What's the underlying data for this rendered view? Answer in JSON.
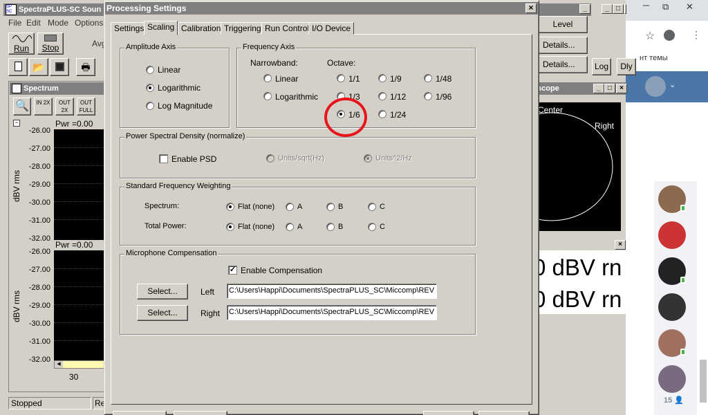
{
  "main_window": {
    "title": "SpectraPLUS-SC Soun",
    "menu": [
      "File",
      "Edit",
      "Mode",
      "Options"
    ],
    "run": "Run",
    "stop": "Stop",
    "avg": "Avg",
    "status": "Stopped",
    "status2": "Re"
  },
  "spectrum": {
    "title": "Spectrum",
    "zoom_in": "IN 2X",
    "zoom_out": "OUT 2X",
    "zoom_full": "OUT FULL",
    "top": {
      "header": "Pwr =0.00",
      "yticks": [
        "-26.00",
        "-27.00",
        "-28.00",
        "-29.00",
        "-30.00",
        "-31.00",
        "-32.00"
      ],
      "ylabel": "dBV rms"
    },
    "bottom": {
      "header": "Pwr =0.00",
      "yticks": [
        "-26.00",
        "-27.00",
        "-28.00",
        "-29.00",
        "-30.00",
        "-31.00",
        "-32.00"
      ],
      "ylabel": "dBV rms",
      "x_tick": "30"
    }
  },
  "right_panel": {
    "buttons": [
      "Level",
      "Details...",
      "Details..."
    ],
    "log": "Log",
    "dly": "Dly",
    "scope_title": "scope",
    "scope_center": "Center",
    "scope_right": "Right",
    "meter1": "0 dBV rn",
    "meter2": "0 dBV rn"
  },
  "browser": {
    "text_snippet": "нт темы",
    "count": "15"
  },
  "dialog": {
    "title": "Processing Settings",
    "tabs": [
      "Settings",
      "Scaling",
      "Calibration",
      "Triggering",
      "Run Control",
      "I/O Device"
    ],
    "active_tab": "Scaling",
    "amplitude": {
      "label": "Amplitude Axis",
      "options": [
        "Linear",
        "Logarithmic",
        "Log Magnitude"
      ],
      "selected": "Logarithmic"
    },
    "frequency": {
      "label": "Frequency Axis",
      "narrowband_label": "Narrowband:",
      "narrowband": [
        "Linear",
        "Logarithmic"
      ],
      "octave_label": "Octave:",
      "octave": [
        "1/1",
        "1/9",
        "1/48",
        "1/3",
        "1/12",
        "1/96",
        "1/6",
        "1/24"
      ],
      "selected": "1/6"
    },
    "psd": {
      "label": "Power Spectral Density (normalize)",
      "enable": "Enable PSD",
      "enabled": false,
      "units1": "Units/sqrt(Hz)",
      "units2": "Units^2/Hz"
    },
    "weighting": {
      "label": "Standard Frequency Weighting",
      "rows": [
        {
          "name": "Spectrum:",
          "selected": "Flat (none)"
        },
        {
          "name": "Total Power:",
          "selected": "Flat (none)"
        }
      ],
      "options": [
        "Flat (none)",
        "A",
        "B",
        "C"
      ]
    },
    "mic": {
      "label": "Microphone Compensation",
      "enable": "Enable Compensation",
      "enabled": true,
      "select": "Select...",
      "left_label": "Left",
      "right_label": "Right",
      "left_path": "C:\\Users\\Happi\\Documents\\SpectraPLUS_SC\\Miccomp\\REV",
      "right_path": "C:\\Users\\Happi\\Documents\\SpectraPLUS_SC\\Miccomp\\REV"
    }
  }
}
